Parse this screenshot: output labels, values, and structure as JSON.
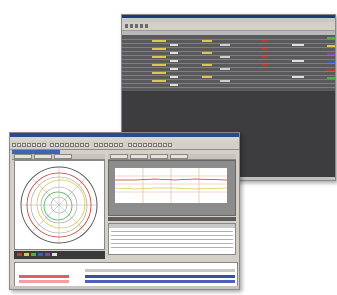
{
  "colors": {
    "back_window_bg": "#3d3d3f",
    "titlebar": "#1d3b7a",
    "front_window_bg": "#d4d0c8",
    "accent_yellow": "#d9c94a",
    "accent_red": "#c0392b",
    "accent_green": "#4caf50",
    "accent_blue": "#3a5ec8",
    "accent_purple": "#8a3fb3"
  },
  "icons": [
    "toolbar-button-icon",
    "polar-chart-icon",
    "legend-swatch-icon"
  ]
}
